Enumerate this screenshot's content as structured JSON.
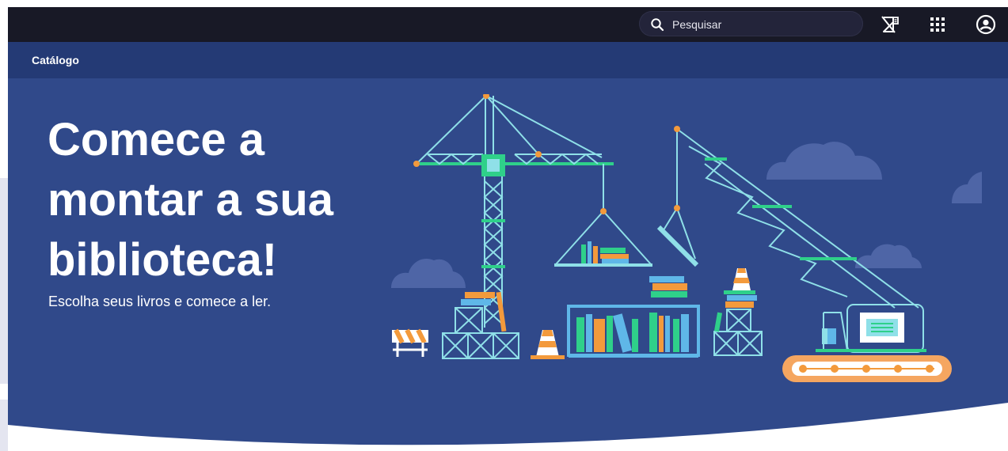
{
  "topbar": {
    "search": {
      "placeholder": "Pesquisar",
      "value": ""
    },
    "icons": [
      "search-icon",
      "notifications-off-icon",
      "apps-grid-icon",
      "account-icon"
    ]
  },
  "subbar": {
    "title": "Catálogo"
  },
  "hero": {
    "heading": "Comece a montar a sua biblioteca!",
    "subtitle": "Escolha seus livros e comece a ler."
  },
  "colors": {
    "topbar": "#181926",
    "subbar": "#243a75",
    "hero": "#30498a",
    "accent_green": "#2fd08a",
    "accent_orange": "#f39a3c",
    "accent_blue": "#5fb7e8"
  }
}
